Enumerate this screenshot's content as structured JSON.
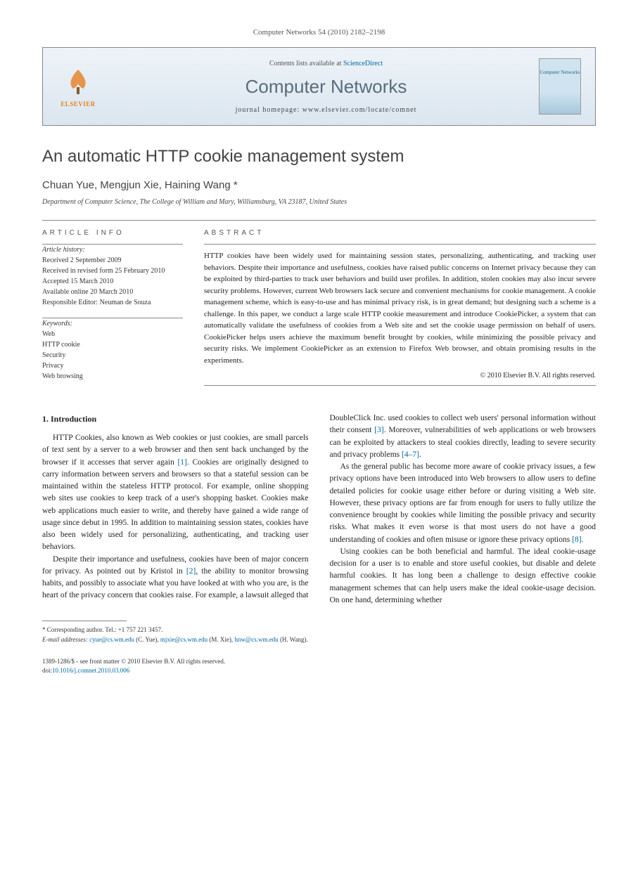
{
  "header": {
    "journal_ref": "Computer Networks 54 (2010) 2182–2198",
    "contents_prefix": "Contents lists available at ",
    "contents_link": "ScienceDirect",
    "journal_name": "Computer Networks",
    "homepage_label": "journal homepage: www.elsevier.com/locate/comnet",
    "publisher": "ELSEVIER",
    "cover_label": "Computer Networks"
  },
  "article": {
    "title": "An automatic HTTP cookie management system",
    "authors": "Chuan Yue, Mengjun Xie, Haining Wang *",
    "affiliation": "Department of Computer Science, The College of William and Mary, Williamsburg, VA 23187, United States"
  },
  "meta": {
    "info_heading": "ARTICLE INFO",
    "history_label": "Article history:",
    "history": [
      "Received 2 September 2009",
      "Received in revised form 25 February 2010",
      "Accepted 15 March 2010",
      "Available online 20 March 2010",
      "Responsible Editor: Neuman de Souza"
    ],
    "keywords_label": "Keywords:",
    "keywords": [
      "Web",
      "HTTP cookie",
      "Security",
      "Privacy",
      "Web browsing"
    ]
  },
  "abstract": {
    "heading": "ABSTRACT",
    "text": "HTTP cookies have been widely used for maintaining session states, personalizing, authenticating, and tracking user behaviors. Despite their importance and usefulness, cookies have raised public concerns on Internet privacy because they can be exploited by third-parties to track user behaviors and build user profiles. In addition, stolen cookies may also incur severe security problems. However, current Web browsers lack secure and convenient mechanisms for cookie management. A cookie management scheme, which is easy-to-use and has minimal privacy risk, is in great demand; but designing such a scheme is a challenge. In this paper, we conduct a large scale HTTP cookie measurement and introduce CookiePicker, a system that can automatically validate the usefulness of cookies from a Web site and set the cookie usage permission on behalf of users. CookiePicker helps users achieve the maximum benefit brought by cookies, while minimizing the possible privacy and security risks. We implement CookiePicker as an extension to Firefox Web browser, and obtain promising results in the experiments.",
    "copyright": "© 2010 Elsevier B.V. All rights reserved."
  },
  "body": {
    "intro_heading": "1. Introduction",
    "p1a": "HTTP Cookies, also known as Web cookies or just cookies, are small parcels of text sent by a server to a web browser and then sent back unchanged by the browser if it accesses that server again ",
    "p1_ref1": "[1]",
    "p1b": ". Cookies are originally designed to carry information between servers and browsers so that a stateful session can be maintained within the stateless HTTP protocol. For example, online shopping web sites use cookies to keep track of a user's shopping basket. Cookies make web applications much easier to write, and thereby have gained a wide range of usage since debut in 1995. In addition to maintaining session states, cookies have also been widely used for personalizing, authenticating, and tracking user behaviors.",
    "p2a": "Despite their importance and usefulness, cookies have been of major concern for privacy. As pointed out by Kristol in ",
    "p2_ref": "[2]",
    "p2b": ", the ability to monitor browsing habits, and possibly to associate what you have looked at with who you are, is the heart of the privacy concern that cookies raise. For example, a lawsuit alleged that DoubleClick Inc. used cookies to collect web users' personal information without their consent ",
    "p2_ref2": "[3]",
    "p2c": ". Moreover, vulnerabilities of web applications or web browsers can be exploited by attackers to steal cookies directly, leading to severe security and privacy problems ",
    "p2_ref3": "[4–7]",
    "p2d": ".",
    "p3a": "As the general public has become more aware of cookie privacy issues, a few privacy options have been introduced into Web browsers to allow users to define detailed policies for cookie usage either before or during visiting a Web site. However, these privacy options are far from enough for users to fully utilize the convenience brought by cookies while limiting the possible privacy and security risks. What makes it even worse is that most users do not have a good understanding of cookies and often misuse or ignore these privacy options ",
    "p3_ref": "[8]",
    "p3b": ".",
    "p4": "Using cookies can be both beneficial and harmful. The ideal cookie-usage decision for a user is to enable and store useful cookies, but disable and delete harmful cookies. It has long been a challenge to design effective cookie management schemes that can help users make the ideal cookie-usage decision. On one hand, determining whether"
  },
  "footnotes": {
    "corr": "* Corresponding author. Tel.: +1 757 221 3457.",
    "email_label": "E-mail addresses: ",
    "email1": "cyue@cs.wm.edu",
    "email1_name": " (C. Yue), ",
    "email2": "mjxie@cs.wm.edu",
    "email2_name": " (M. Xie), ",
    "email3": "hnw@cs.wm.edu",
    "email3_name": " (H. Wang)."
  },
  "footer": {
    "issn": "1389-1286/$ - see front matter © 2010 Elsevier B.V. All rights reserved.",
    "doi_label": "doi:",
    "doi": "10.1016/j.comnet.2010.03.006"
  }
}
